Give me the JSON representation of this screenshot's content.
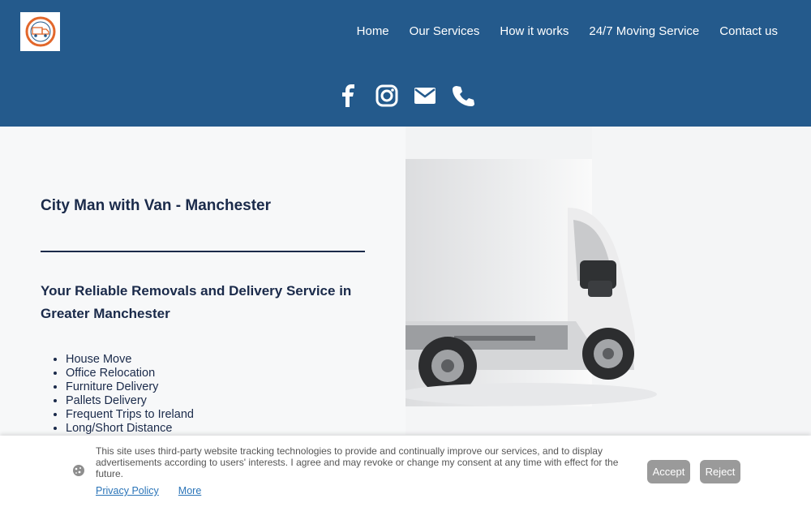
{
  "header": {
    "logo_icon": "van-logo-icon",
    "nav": [
      {
        "label": "Home"
      },
      {
        "label": "Our Services"
      },
      {
        "label": "How it works"
      },
      {
        "label": "24/7 Moving Service"
      },
      {
        "label": "Contact us"
      }
    ],
    "social_icons": [
      "facebook-icon",
      "instagram-icon",
      "email-icon",
      "phone-icon"
    ],
    "brand_color": "#245a8c"
  },
  "hero": {
    "title": "City Man with Van - Manchester",
    "subtitle": "Your Reliable Removals and Delivery Service in Greater Manchester",
    "services": [
      "House Move",
      "Office Relocation",
      "Furniture Delivery",
      "Pallets Delivery",
      "Frequent Trips to Ireland",
      "Long/Short Distance"
    ],
    "image_icon": "van-photo"
  },
  "cookie_banner": {
    "text": "This site uses third-party website tracking technologies to provide and continually improve our services, and to display advertisements according to users' interests. I agree and may revoke or change my consent at any time with effect for the future.",
    "privacy_link": "Privacy Policy",
    "more_link": "More",
    "accept_label": "Accept",
    "reject_label": "Reject"
  }
}
